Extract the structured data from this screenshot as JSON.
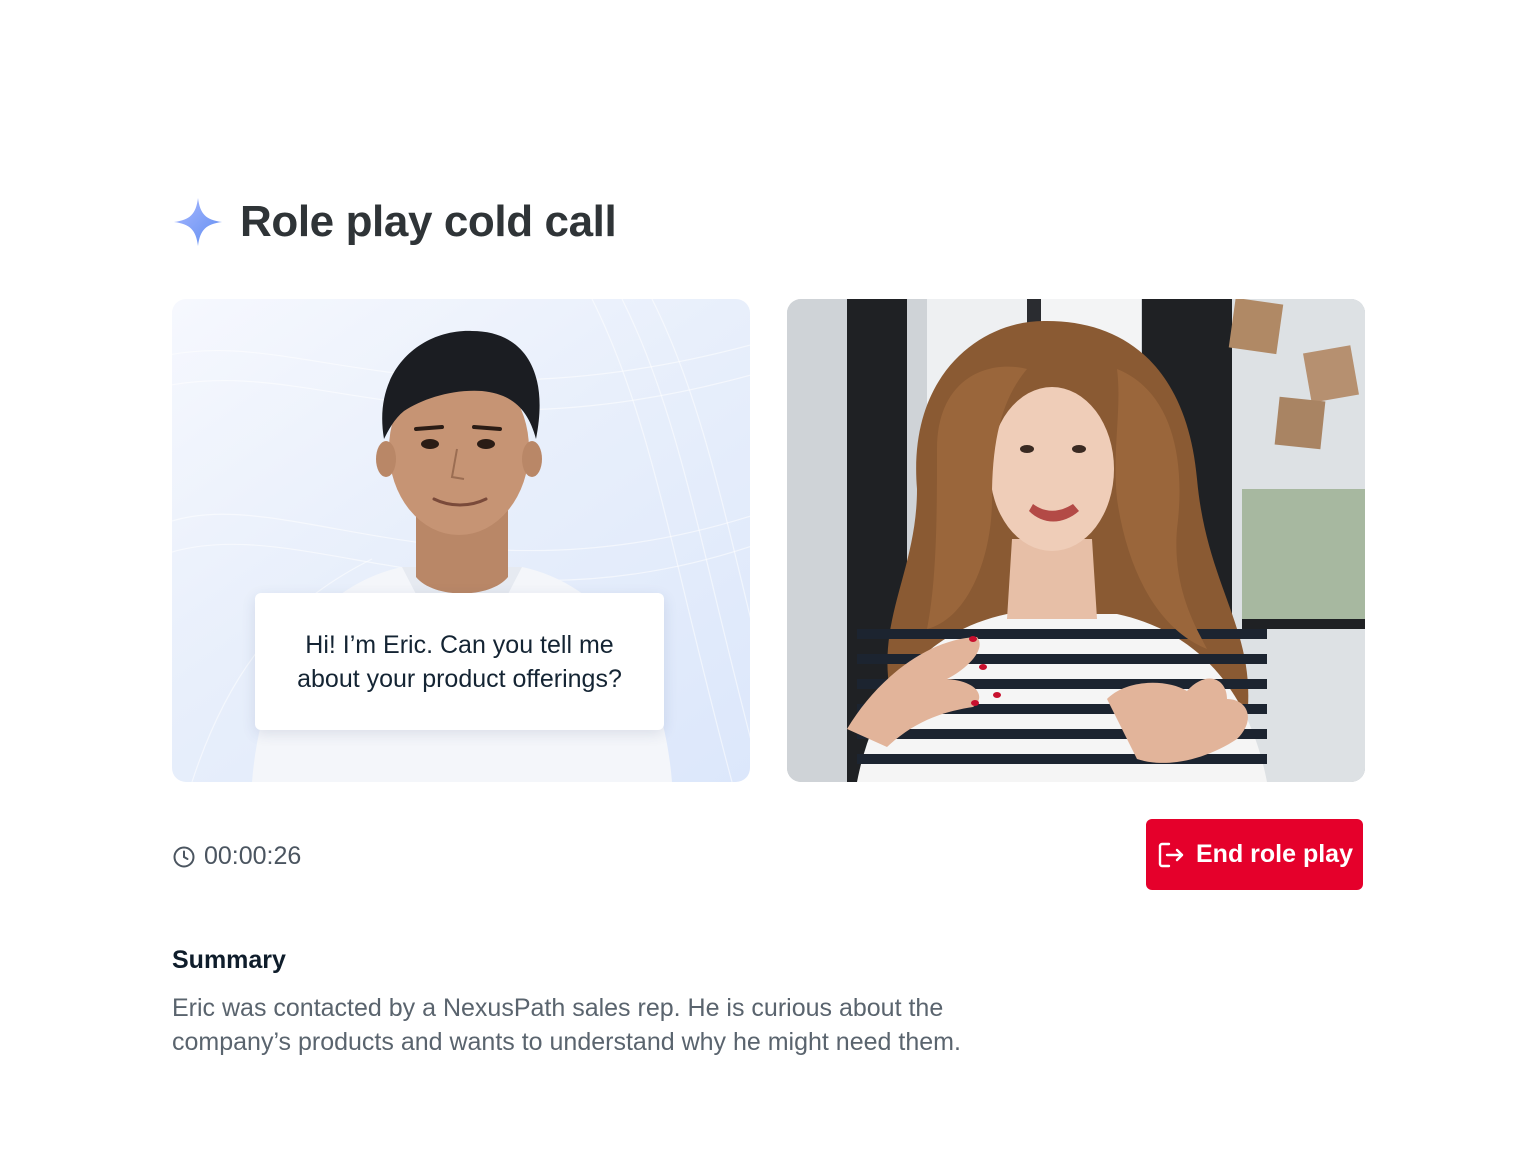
{
  "page": {
    "title": "Role play cold call"
  },
  "panels": {
    "ai_persona": {
      "speech": "Hi! I’m Eric. Can you tell me about your product offerings?"
    },
    "user_video": {}
  },
  "controls": {
    "timer": "00:00:26",
    "end_label": "End role play"
  },
  "summary": {
    "heading": "Summary",
    "text": "Eric was contacted by a NexusPath sales rep. He is curious about the company’s products and wants to understand why he might need them."
  },
  "colors": {
    "accent_sparkle": "#7aa2f7",
    "end_button": "#e5002b",
    "title": "#2f3437"
  }
}
